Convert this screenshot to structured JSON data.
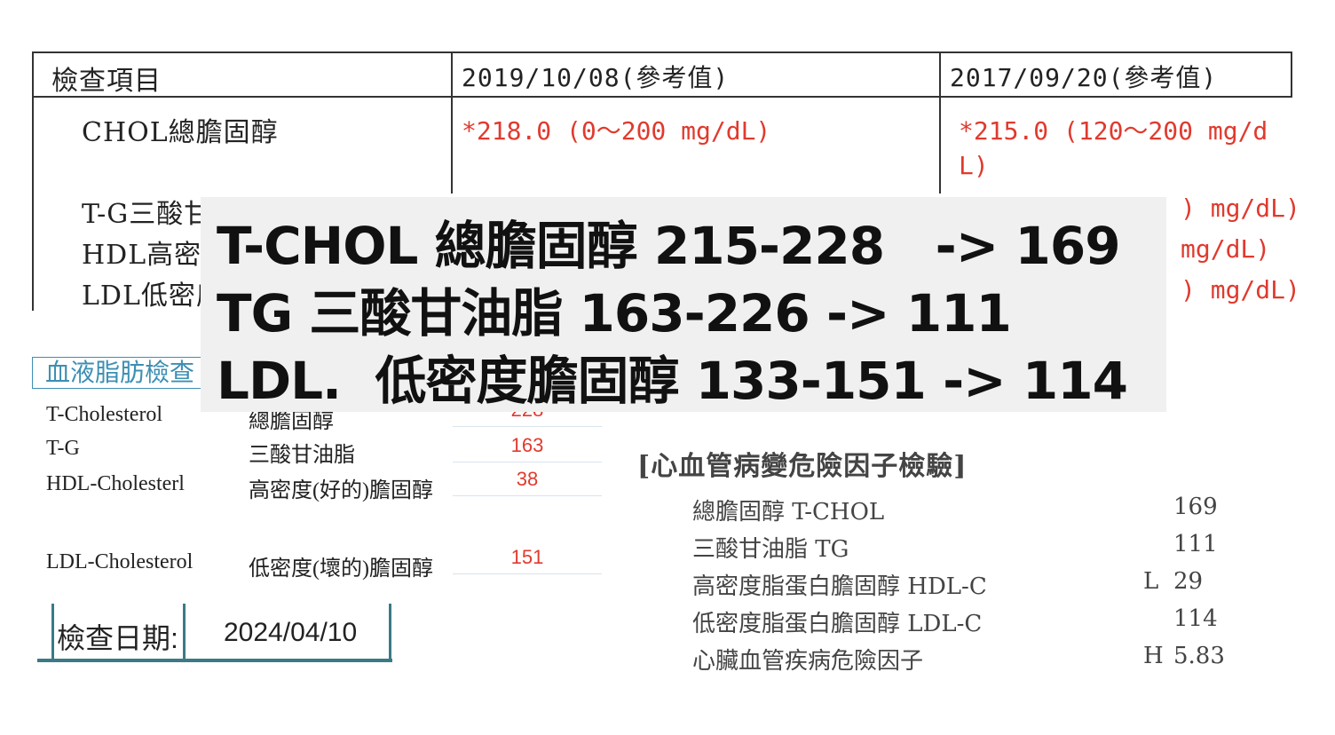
{
  "report_table": {
    "header": {
      "item": "檢查項目",
      "date1": "2019/10/08(參考值)",
      "date2": "2017/09/20(參考值)"
    },
    "rows": [
      {
        "label": "CHOL總膽固醇",
        "val1": "*218.0 (0～200 mg/dL)",
        "val2_line1": "*215.0 (120～200 mg/d",
        "val2_line2": "L)"
      },
      {
        "label": "T-G三酸甘",
        "val2_tail": ") mg/dL)"
      },
      {
        "label": "HDL高密度",
        "val2_tail": "mg/dL)"
      },
      {
        "label": "LDL低密度",
        "val2_tail": ") mg/dL)"
      }
    ]
  },
  "lipid_panel": {
    "title": "血液脂肪檢查",
    "rows": [
      {
        "name": "T-Cholesterol",
        "cn": "總膽固醇",
        "value": "228"
      },
      {
        "name": "T-G",
        "cn": "三酸甘油脂",
        "value": "163"
      },
      {
        "name": "HDL-Cholesterl",
        "cn": "高密度(好的)膽固醇",
        "value": "38"
      },
      {
        "name": "LDL-Cholesterol",
        "cn": "低密度(壞的)膽固醇",
        "value": "151"
      }
    ],
    "date_label": "檢查日期:",
    "date_value": "2024/04/10"
  },
  "cardio_panel": {
    "title": "[心血管病變危險因子檢驗]",
    "rows": [
      {
        "label": "總膽固醇  T-CHOL",
        "flag": "",
        "value": "169"
      },
      {
        "label": "三酸甘油脂  TG",
        "flag": "",
        "value": "111"
      },
      {
        "label": "高密度脂蛋白膽固醇  HDL-C",
        "flag": "L",
        "value": "29"
      },
      {
        "label": "低密度脂蛋白膽固醇  LDL-C",
        "flag": "",
        "value": "114"
      },
      {
        "label": "心臟血管疾病危險因子",
        "flag": "H",
        "value": "5.83"
      }
    ]
  },
  "overlay_summary": {
    "lines": [
      "T-CHOL 總膽固醇 215-228   -> 169",
      "TG 三酸甘油脂 163-226 -> 111",
      "LDL.  低密度膽固醇 133-151 -> 114"
    ]
  },
  "colors": {
    "abnormal_red": "#e03a2e",
    "panel_blue": "#3d8fb3",
    "datebox_teal": "#3b7a86",
    "overlay_bg": "#f0f0f0"
  }
}
